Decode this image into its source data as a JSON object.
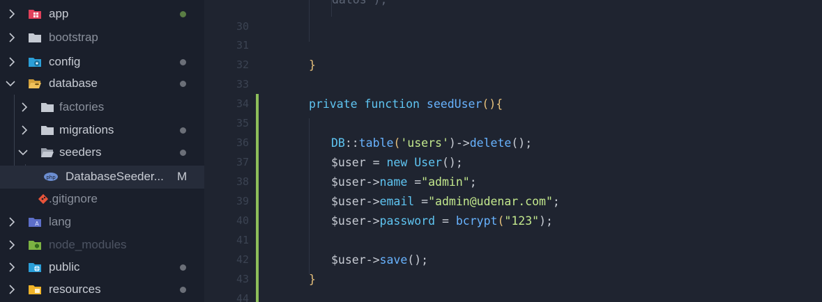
{
  "sidebar": {
    "items": [
      {
        "label": "app",
        "icon": "app-folder-icon",
        "expanded": false,
        "indicator": "dot-green"
      },
      {
        "label": "bootstrap",
        "icon": "folder-icon",
        "expanded": false,
        "indicator": ""
      },
      {
        "label": "config",
        "icon": "config-folder-icon",
        "expanded": false,
        "indicator": "dot"
      },
      {
        "label": "database",
        "icon": "database-folder-icon",
        "expanded": true,
        "indicator": "dot"
      },
      {
        "label": "factories",
        "icon": "folder-icon",
        "expanded": false,
        "indicator": ""
      },
      {
        "label": "migrations",
        "icon": "folder-icon",
        "expanded": false,
        "indicator": "dot"
      },
      {
        "label": "seeders",
        "icon": "folder-open-icon",
        "expanded": true,
        "indicator": "dot"
      },
      {
        "label": "DatabaseSeeder...",
        "icon": "php-file-icon",
        "indicator": "M"
      },
      {
        "label": ".gitignore",
        "icon": "git-file-icon",
        "indicator": ""
      },
      {
        "label": "lang",
        "icon": "lang-folder-icon",
        "expanded": false,
        "indicator": ""
      },
      {
        "label": "node_modules",
        "icon": "node-folder-icon",
        "expanded": false,
        "indicator": ""
      },
      {
        "label": "public",
        "icon": "public-folder-icon",
        "expanded": false,
        "indicator": "dot"
      },
      {
        "label": "resources",
        "icon": "resources-folder-icon",
        "expanded": false,
        "indicator": "dot"
      }
    ]
  },
  "editor": {
    "partial_top_line": "datos\");",
    "line_numbers": [
      "30",
      "31",
      "32",
      "33",
      "34",
      "35",
      "36",
      "37",
      "38",
      "39",
      "40",
      "41",
      "42",
      "43",
      "44"
    ],
    "code": {
      "brace_close_1": "}",
      "private_kw": "private",
      "function_kw": "function",
      "method_name": "seedUser",
      "method_open": "(){",
      "db_class": "DB",
      "db_sep": "::",
      "table_fn": "table",
      "table_open": "(",
      "users_str": "'users'",
      "table_close": ")->",
      "delete_fn": "delete",
      "delete_end": "();",
      "user_var": "$user",
      "assign": " = ",
      "new_kw": "new",
      "user_class": "User",
      "ctor_end": "();",
      "name_prop": "name",
      "name_assign": " =",
      "name_val": "\"admin\"",
      "semi": ";",
      "email_prop": "email",
      "email_assign": " =",
      "email_val": "\"admin@udenar.com\"",
      "password_prop": "password",
      "password_assign": " = ",
      "bcrypt_fn": "bcrypt",
      "bcrypt_open": "(",
      "bcrypt_val": "\"123\"",
      "bcrypt_close": ");",
      "arrow": "->",
      "save_fn": "save",
      "save_end": "();",
      "brace_close_2": "}"
    }
  },
  "colors": {
    "sidebar_bg": "#1a1f2b",
    "editor_bg": "#1f2430",
    "git_modified_bar": "#8dbe5a",
    "keyword": "#5fc5f2",
    "string": "#c3e88d"
  }
}
